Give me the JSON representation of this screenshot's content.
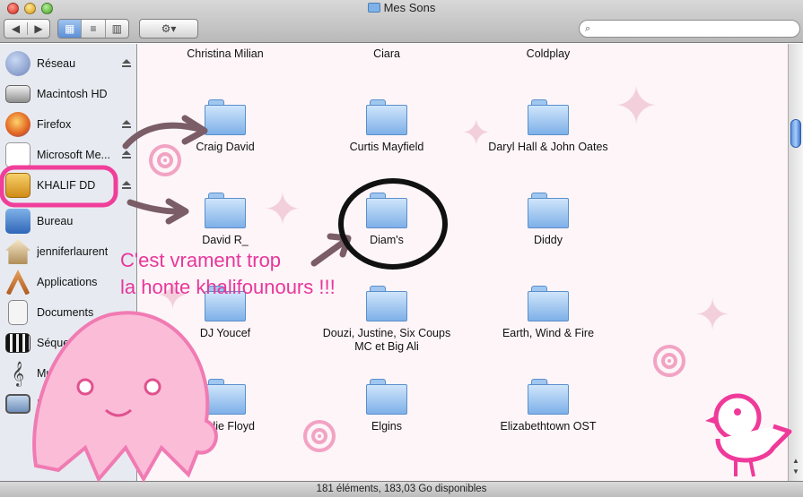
{
  "window": {
    "title": "Mes Sons"
  },
  "toolbar": {
    "back_glyph": "◀",
    "forward_glyph": "▶",
    "view_icons": [
      "icon-view",
      "list-view",
      "column-view"
    ],
    "view_glyphs": [
      "▦",
      "≡",
      "▥"
    ],
    "active_view": "icon-view",
    "action_glyph": "⚙▾",
    "search_glyph": "🔍"
  },
  "sidebar": {
    "items": [
      {
        "label": "Réseau",
        "icon": "network-globe-icon",
        "eject": true
      },
      {
        "label": "Macintosh HD",
        "icon": "hard-disk-icon",
        "eject": false
      },
      {
        "label": "Firefox",
        "icon": "firefox-icon",
        "eject": true
      },
      {
        "label": "Microsoft Me...",
        "icon": "microsoft-disk-icon",
        "eject": true
      },
      {
        "label": "KHALIF DD",
        "icon": "usb-drive-icon",
        "eject": true
      }
    ],
    "places": [
      {
        "label": "Bureau",
        "icon": "desktop-icon"
      },
      {
        "label": "jenniferlaurent",
        "icon": "home-icon"
      },
      {
        "label": "Applications",
        "icon": "applications-icon"
      },
      {
        "label": "Documents",
        "icon": "documents-icon"
      },
      {
        "label": "Séquences",
        "icon": "movies-icon"
      },
      {
        "label": "Musique",
        "icon": "music-icon"
      },
      {
        "label": "Images",
        "icon": "pictures-icon"
      }
    ]
  },
  "folders": [
    {
      "label": "Christina Milian"
    },
    {
      "label": "Ciara"
    },
    {
      "label": "Coldplay"
    },
    {
      "label": "Craig David"
    },
    {
      "label": "Curtis Mayfield"
    },
    {
      "label": "Daryl Hall & John Oates"
    },
    {
      "label": "David R_"
    },
    {
      "label": "Diam's"
    },
    {
      "label": "Diddy"
    },
    {
      "label": "DJ Youcef"
    },
    {
      "label": "Douzi, Justine, Six Coups\nMC et Big Ali"
    },
    {
      "label": "Earth, Wind & Fire"
    },
    {
      "label": "Eddie Floyd"
    },
    {
      "label": "Elgins"
    },
    {
      "label": "Elizabethtown OST"
    }
  ],
  "status": {
    "text": "181 éléments, 183,03 Go disponibles"
  },
  "annotation": {
    "text": "C'est vrament trop\nla honte khalifounours !!!"
  },
  "colors": {
    "annotation_pink": "#e8369b",
    "selection_blue": "#5c8fd6"
  }
}
